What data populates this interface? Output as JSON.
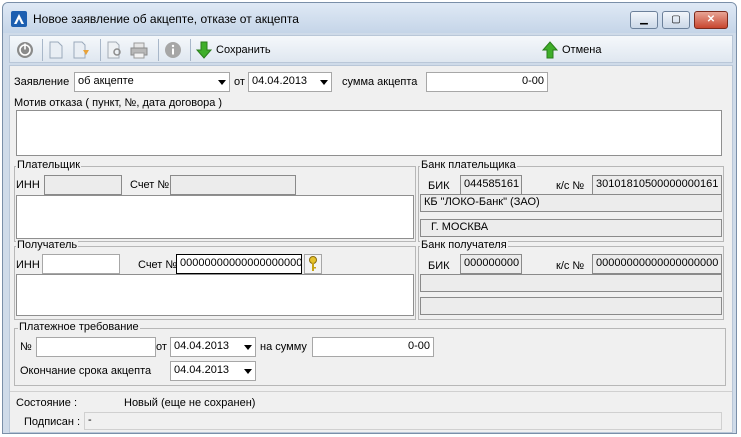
{
  "window": {
    "title": "Новое заявление об акцепте, отказе от акцепта"
  },
  "toolbar": {
    "save_label": "Сохранить",
    "cancel_label": "Отмена"
  },
  "form": {
    "statement_label": "Заявление",
    "statement_value": "об акцепте",
    "from_label": "от",
    "date": "04.04.2013",
    "amount_label": "сумма акцепта",
    "amount": "0-00",
    "reason_label": "Мотив отказа ( пункт, №, дата договора )",
    "reason_value": ""
  },
  "payer": {
    "group_label": "Плательщик",
    "inn_label": "ИНН",
    "inn": "",
    "account_label": "Счет №",
    "account": "",
    "name": ""
  },
  "payer_bank": {
    "group_label": "Банк плательщика",
    "bik_label": "БИК",
    "bik": "044585161",
    "ks_label": "к/с №",
    "ks": "30101810500000000161",
    "name": "КБ \"ЛОКО-Банк\" (ЗАО)",
    "city": "Г. МОСКВА"
  },
  "recipient": {
    "group_label": "Получатель",
    "inn_label": "ИНН",
    "inn": "",
    "account_label": "Счет №",
    "account": "00000000000000000000",
    "name": ""
  },
  "recipient_bank": {
    "group_label": "Банк получателя",
    "bik_label": "БИК",
    "bik": "000000000",
    "ks_label": "к/с №",
    "ks": "00000000000000000000",
    "name": "",
    "city": ""
  },
  "payment_request": {
    "group_label": "Платежное требование",
    "number_label": "№",
    "number": "",
    "from_label": "от",
    "date": "04.04.2013",
    "sum_label": "на сумму",
    "sum": "0-00",
    "deadline_label": "Окончание срока акцепта",
    "deadline": "04.04.2013"
  },
  "status": {
    "state_label": "Состояние :",
    "state_value": "Новый (еще не сохранен)",
    "signed_label": "Подписан :",
    "signed_value": "-"
  }
}
